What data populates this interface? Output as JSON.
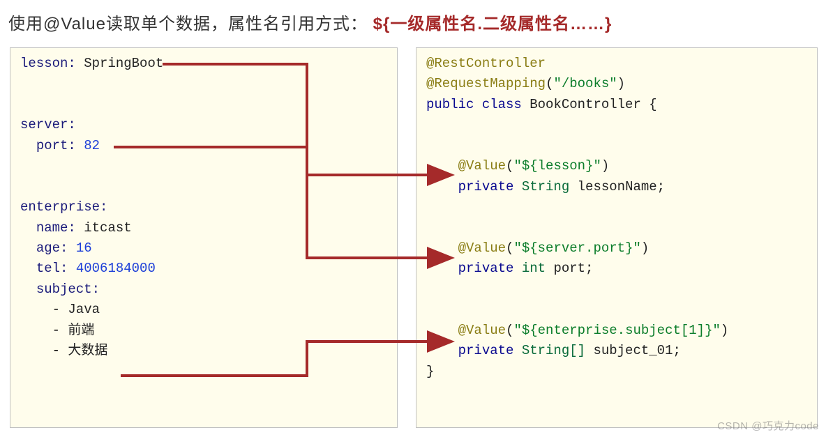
{
  "heading": {
    "part1": "使用@Value读取单个数据，属性名引用方式：",
    "part2": "${一级属性名.二级属性名……}"
  },
  "yaml": {
    "lesson_key": "lesson",
    "lesson_val": "SpringBoot",
    "server_key": "server",
    "server_port_key": "port",
    "server_port_val": "82",
    "enterprise_key": "enterprise",
    "name_key": "name",
    "name_val": "itcast",
    "age_key": "age",
    "age_val": "16",
    "tel_key": "tel",
    "tel_val": "4006184000",
    "subject_key": "subject",
    "subject_items": [
      "Java",
      "前端",
      "大数据"
    ]
  },
  "java": {
    "anno_rest": "@RestController",
    "anno_reqmap_name": "@RequestMapping",
    "anno_reqmap_arg": "\"/books\"",
    "class_decl_pre": "public class ",
    "class_name": "BookController",
    "value1_name": "@Value",
    "value1_arg": "\"${lesson}\"",
    "field1_mod": "private ",
    "field1_type": "String",
    "field1_name": " lessonName;",
    "value2_name": "@Value",
    "value2_arg": "\"${server.port}\"",
    "field2_mod": "private ",
    "field2_type": "int",
    "field2_name": " port;",
    "value3_name": "@Value",
    "value3_arg": "\"${enterprise.subject[1]}\"",
    "field3_mod": "private ",
    "field3_type": "String[]",
    "field3_name": " subject_01;"
  },
  "watermark": "CSDN @巧克力code",
  "chart_data": {
    "type": "table",
    "description": "Arrows map YAML config values on the left to @Value-annotated Java fields on the right.",
    "mappings": [
      {
        "source": "lesson: SpringBoot",
        "target": "@Value(\"${lesson}\") private String lessonName;"
      },
      {
        "source": "server.port: 82",
        "target": "@Value(\"${server.port}\") private int port;"
      },
      {
        "source": "enterprise.subject[1] = 前端",
        "target": "@Value(\"${enterprise.subject[1]}\") private String[] subject_01;"
      }
    ]
  }
}
